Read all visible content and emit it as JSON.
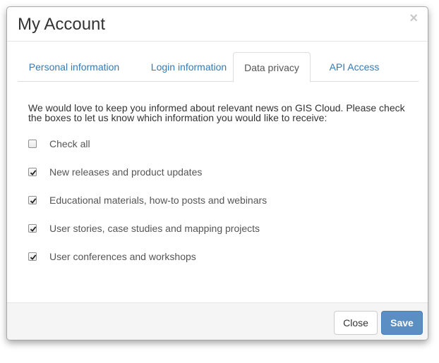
{
  "modal": {
    "title": "My Account",
    "close_symbol": "×"
  },
  "tabs": [
    {
      "label": "Personal information",
      "active": false
    },
    {
      "label": "Login information",
      "active": false
    },
    {
      "label": "Data privacy",
      "active": true
    },
    {
      "label": "API Access",
      "active": false
    }
  ],
  "privacy": {
    "intro": "We would love to keep you informed about relevant news on GIS Cloud. Please check the boxes to let us know which information you would like to receive:",
    "options": [
      {
        "label": "Check all",
        "checked": false
      },
      {
        "label": "New releases and product updates",
        "checked": true
      },
      {
        "label": "Educational materials, how-to posts and webinars",
        "checked": true
      },
      {
        "label": "User stories, case studies and mapping projects",
        "checked": true
      },
      {
        "label": "User conferences and workshops",
        "checked": true
      }
    ]
  },
  "footer": {
    "close_label": "Close",
    "save_label": "Save"
  },
  "colors": {
    "link": "#337ab7",
    "primary": "#5b8fc4"
  }
}
